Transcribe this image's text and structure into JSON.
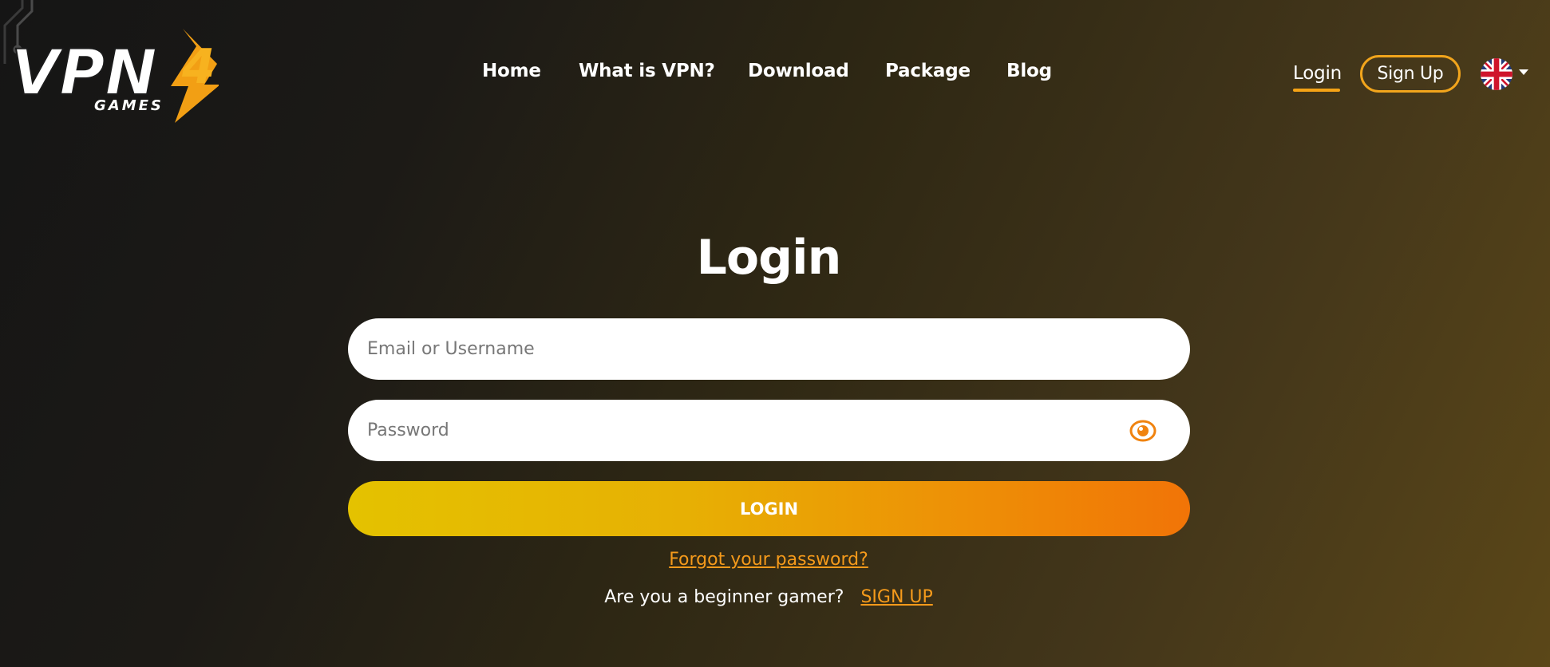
{
  "logo": {
    "text": "VPN",
    "digit": "4",
    "sub": "GAMES"
  },
  "nav": {
    "items": [
      {
        "label": "Home"
      },
      {
        "label": "What is VPN?"
      },
      {
        "label": "Download"
      },
      {
        "label": "Package"
      },
      {
        "label": "Blog"
      }
    ],
    "login_label": "Login",
    "signup_label": "Sign Up",
    "language": {
      "icon": "uk-flag-icon",
      "caret_icon": "caret-down-icon"
    }
  },
  "form": {
    "title": "Login",
    "email_placeholder": "Email or Username",
    "email_value": "",
    "password_placeholder": "Password",
    "password_value": "",
    "eye_icon": "eye-icon",
    "submit_label": "LOGIN",
    "forgot_label": "Forgot your password?",
    "beginner_text": "Are you a beginner gamer?",
    "signup_link_label": "SIGN UP"
  },
  "colors": {
    "accent": "#f59a1b",
    "button_gradient_start": "#e4c200",
    "button_gradient_end": "#f17407",
    "signup_border": "#f2a51c"
  }
}
